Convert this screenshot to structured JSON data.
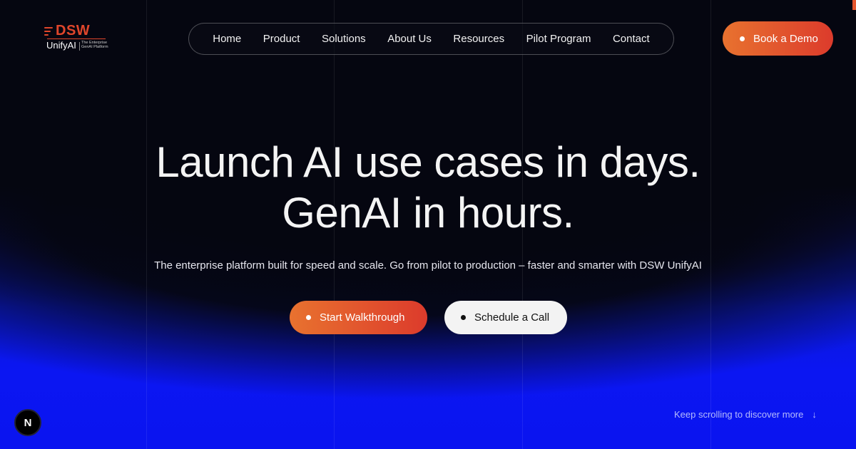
{
  "brand": {
    "logo_main": "DSW",
    "logo_sub": "UnifyAI",
    "logo_tagline": "The Enterprise GenAI Platform",
    "accent_color": "#e0462b"
  },
  "nav": {
    "items": [
      "Home",
      "Product",
      "Solutions",
      "About Us",
      "Resources",
      "Pilot Program",
      "Contact"
    ]
  },
  "header": {
    "cta_label": "Book a Demo"
  },
  "hero": {
    "headline_line1": "Launch AI use cases in days.",
    "headline_line2": "GenAI in hours.",
    "subheadline": "The enterprise platform built for speed and scale. Go from pilot to production – faster and smarter with DSW UnifyAI",
    "primary_cta": "Start Walkthrough",
    "secondary_cta": "Schedule a Call"
  },
  "footer_hint": {
    "text": "Keep scrolling to discover more",
    "icon": "arrow-down-icon"
  },
  "dev_badge": {
    "letter": "N",
    "icon": "nextjs-badge-icon"
  }
}
